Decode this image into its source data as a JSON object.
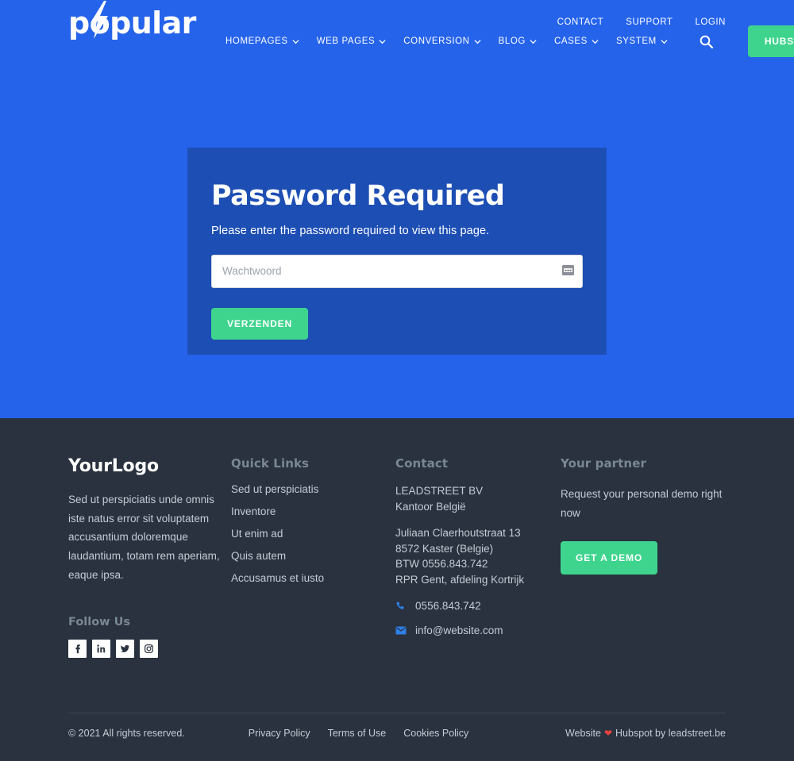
{
  "header": {
    "logo_text": "popular",
    "logo_icon": "lightning-bolt-icon",
    "top_links": [
      {
        "label": "CONTACT"
      },
      {
        "label": "SUPPORT"
      },
      {
        "label": "LOGIN"
      }
    ],
    "nav_items": [
      {
        "label": "HOMEPAGES",
        "icon": "chevron-down-icon"
      },
      {
        "label": "WEB PAGES",
        "icon": "chevron-down-icon"
      },
      {
        "label": "CONVERSION",
        "icon": "chevron-down-icon"
      },
      {
        "label": "BLOG",
        "icon": "chevron-down-icon"
      },
      {
        "label": "CASES",
        "icon": "chevron-down-icon"
      },
      {
        "label": "SYSTEM",
        "icon": "chevron-down-icon"
      }
    ],
    "search_icon": "search-icon",
    "cta_label": "HUBSPOT DEMO"
  },
  "card": {
    "title": "Password Required",
    "subtitle": "Please enter the password required to view this page.",
    "password_placeholder": "Wachtwoord",
    "password_value": "",
    "password_field_icon": "password-manager-icon",
    "submit_label": "VERZENDEN"
  },
  "footer": {
    "brand": {
      "logo": "YourLogo",
      "description": "Sed ut perspiciatis unde omnis iste natus error sit voluptatem accusantium doloremque laudantium, totam rem aperiam, eaque ipsa.",
      "follow_heading": "Follow Us",
      "socials": [
        {
          "name": "facebook-icon"
        },
        {
          "name": "linkedin-icon"
        },
        {
          "name": "twitter-icon"
        },
        {
          "name": "instagram-icon"
        }
      ]
    },
    "quick_links": {
      "heading": "Quick Links",
      "items": [
        {
          "label": "Sed ut perspiciatis"
        },
        {
          "label": "Inventore"
        },
        {
          "label": "Ut enim ad"
        },
        {
          "label": "Quis autem"
        },
        {
          "label": "Accusamus et iusto"
        }
      ]
    },
    "contact": {
      "heading": "Contact",
      "company_line1": "LEADSTREET BV",
      "company_line2": "Kantoor België",
      "address_line1": "Juliaan Claerhoutstraat 13",
      "address_line2": "8572 Kaster (Belgie)",
      "address_line3": "BTW 0556.843.742",
      "address_line4": "RPR Gent, afdeling Kortrijk",
      "phone": "0556.843.742",
      "phone_icon": "phone-icon",
      "email": "info@website.com",
      "email_icon": "envelope-icon"
    },
    "partner": {
      "heading": "Your partner",
      "text": "Request your personal demo right now",
      "button_label": "GET A DEMO"
    },
    "bottom": {
      "copyright": "© 2021 All rights reserved.",
      "policies": [
        {
          "label": "Privacy Policy"
        },
        {
          "label": "Terms of Use"
        },
        {
          "label": "Cookies Policy"
        }
      ],
      "credit_prefix": "Website",
      "credit_heart": "❤",
      "credit_suffix": "Hubspot by leadstreet.be"
    }
  },
  "colors": {
    "hero_blue": "#2563eb",
    "card_blue": "#1d4eb4",
    "accent_green": "#3ed48d",
    "footer_dark": "#29323e",
    "heading_muted": "#7a8795",
    "heart_red": "#e8433e"
  }
}
